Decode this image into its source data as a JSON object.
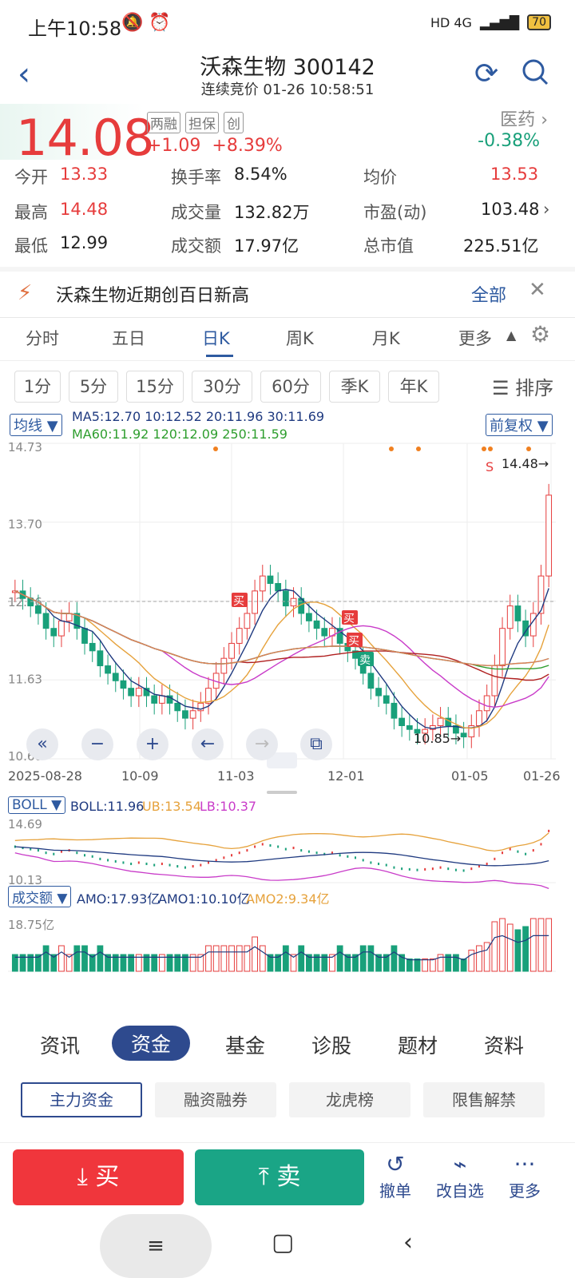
{
  "status_bar": {
    "time": "上午10:58",
    "icons": "🔕 ⏰",
    "network": "HD 4G",
    "battery": "70"
  },
  "header": {
    "stock_name_code": "沃森生物 300142",
    "subtitle": "连续竞价 01-26 10:58:51"
  },
  "quote": {
    "price": "14.08",
    "tags": [
      "两融",
      "担保",
      "创"
    ],
    "change": "+1.09",
    "change_pct": "+8.39%",
    "sector": "医药",
    "sector_change": "-0.38%"
  },
  "stats": {
    "open_label": "今开",
    "open": "13.33",
    "high_label": "最高",
    "high": "14.48",
    "low_label": "最低",
    "low": "12.99",
    "turnover_label": "换手率",
    "turnover": "8.54%",
    "volume_label": "成交量",
    "volume": "132.82万",
    "amount_label": "成交额",
    "amount": "17.97亿",
    "avg_label": "均价",
    "avg": "13.53",
    "pe_label": "市盈(动)",
    "pe": "103.48",
    "mcap_label": "总市值",
    "mcap": "225.51亿"
  },
  "alert": {
    "text": "沃森生物近期创百日新高",
    "link": "全部"
  },
  "periods": {
    "items": [
      "分时",
      "五日",
      "日K",
      "周K",
      "月K",
      "更多"
    ],
    "active": "日K"
  },
  "minute_buttons": [
    "1分",
    "5分",
    "15分",
    "30分",
    "60分",
    "季K",
    "年K"
  ],
  "sort_label": "排序",
  "chart_data": [
    {
      "type": "candlestick",
      "indicator_label": "均线",
      "adjust_label": "前复权",
      "ma_line1": "MA5:12.70 10:12.52 20:11.96 30:11.69",
      "ma_line2": "MA60:11.92 120:12.09 250:11.59",
      "y_ticks": [
        "14.73",
        "13.70",
        "12.66",
        "11.63",
        "10.60"
      ],
      "x_ticks": [
        "2025-08-28",
        "10-09",
        "11-03",
        "12-01",
        "01-05",
        "01-26"
      ],
      "annotations": {
        "high": "14.48→",
        "low": "10.85→",
        "s_mark": "S",
        "buy1": "买",
        "buy2": "买",
        "buy3": "买",
        "sell": "卖"
      },
      "series": [
        {
          "name": "MA5",
          "color": "#1f3a80"
        },
        {
          "name": "MA10",
          "color": "#e6a23c"
        },
        {
          "name": "MA20",
          "color": "#c93cc9"
        },
        {
          "name": "MA30",
          "color": "#b02020"
        },
        {
          "name": "MA60",
          "color": "#2e9e2e"
        },
        {
          "name": "MA120",
          "color": "#4ab8e0"
        },
        {
          "name": "MA250",
          "color": "#e08050"
        }
      ],
      "closes": [
        12.8,
        12.7,
        12.6,
        12.5,
        12.3,
        12.2,
        12.4,
        12.5,
        12.3,
        12.1,
        12.0,
        11.8,
        11.7,
        11.6,
        11.5,
        11.4,
        11.5,
        11.4,
        11.3,
        11.4,
        11.3,
        11.2,
        11.1,
        11.2,
        11.3,
        11.5,
        11.7,
        11.9,
        12.1,
        12.3,
        12.5,
        12.8,
        13.0,
        12.9,
        12.8,
        12.6,
        12.7,
        12.5,
        12.4,
        12.3,
        12.2,
        12.3,
        12.1,
        12.0,
        11.9,
        11.7,
        11.5,
        11.4,
        11.3,
        11.1,
        11.0,
        10.95,
        10.9,
        10.95,
        11.0,
        11.1,
        11.0,
        10.9,
        10.85,
        11.0,
        11.2,
        11.4,
        11.8,
        12.3,
        12.6,
        12.4,
        12.2,
        12.5,
        13.0,
        14.08
      ]
    },
    {
      "type": "line",
      "indicator_label": "BOLL",
      "values_text": {
        "boll": "BOLL:11.96",
        "ub": "UB:13.54",
        "lb": "LB:10.37"
      },
      "y_ticks": [
        "14.69",
        "10.13"
      ]
    },
    {
      "type": "bar",
      "indicator_label": "成交额",
      "values_text": {
        "amo": "AMO:17.93亿",
        "amo1": "AMO1:10.10亿",
        "amo2": "AMO2:9.34亿"
      },
      "y_ticks": [
        "18.75亿"
      ]
    }
  ],
  "bottom_tabs": {
    "items": [
      "资讯",
      "资金",
      "基金",
      "诊股",
      "题材",
      "资料"
    ],
    "active": "资金"
  },
  "sub_tabs": [
    "主力资金",
    "融资融券",
    "龙虎榜",
    "限售解禁"
  ],
  "actions": {
    "buy": "买",
    "sell": "卖",
    "withdraw": "撤单",
    "watchlist": "改自选",
    "more": "更多"
  }
}
